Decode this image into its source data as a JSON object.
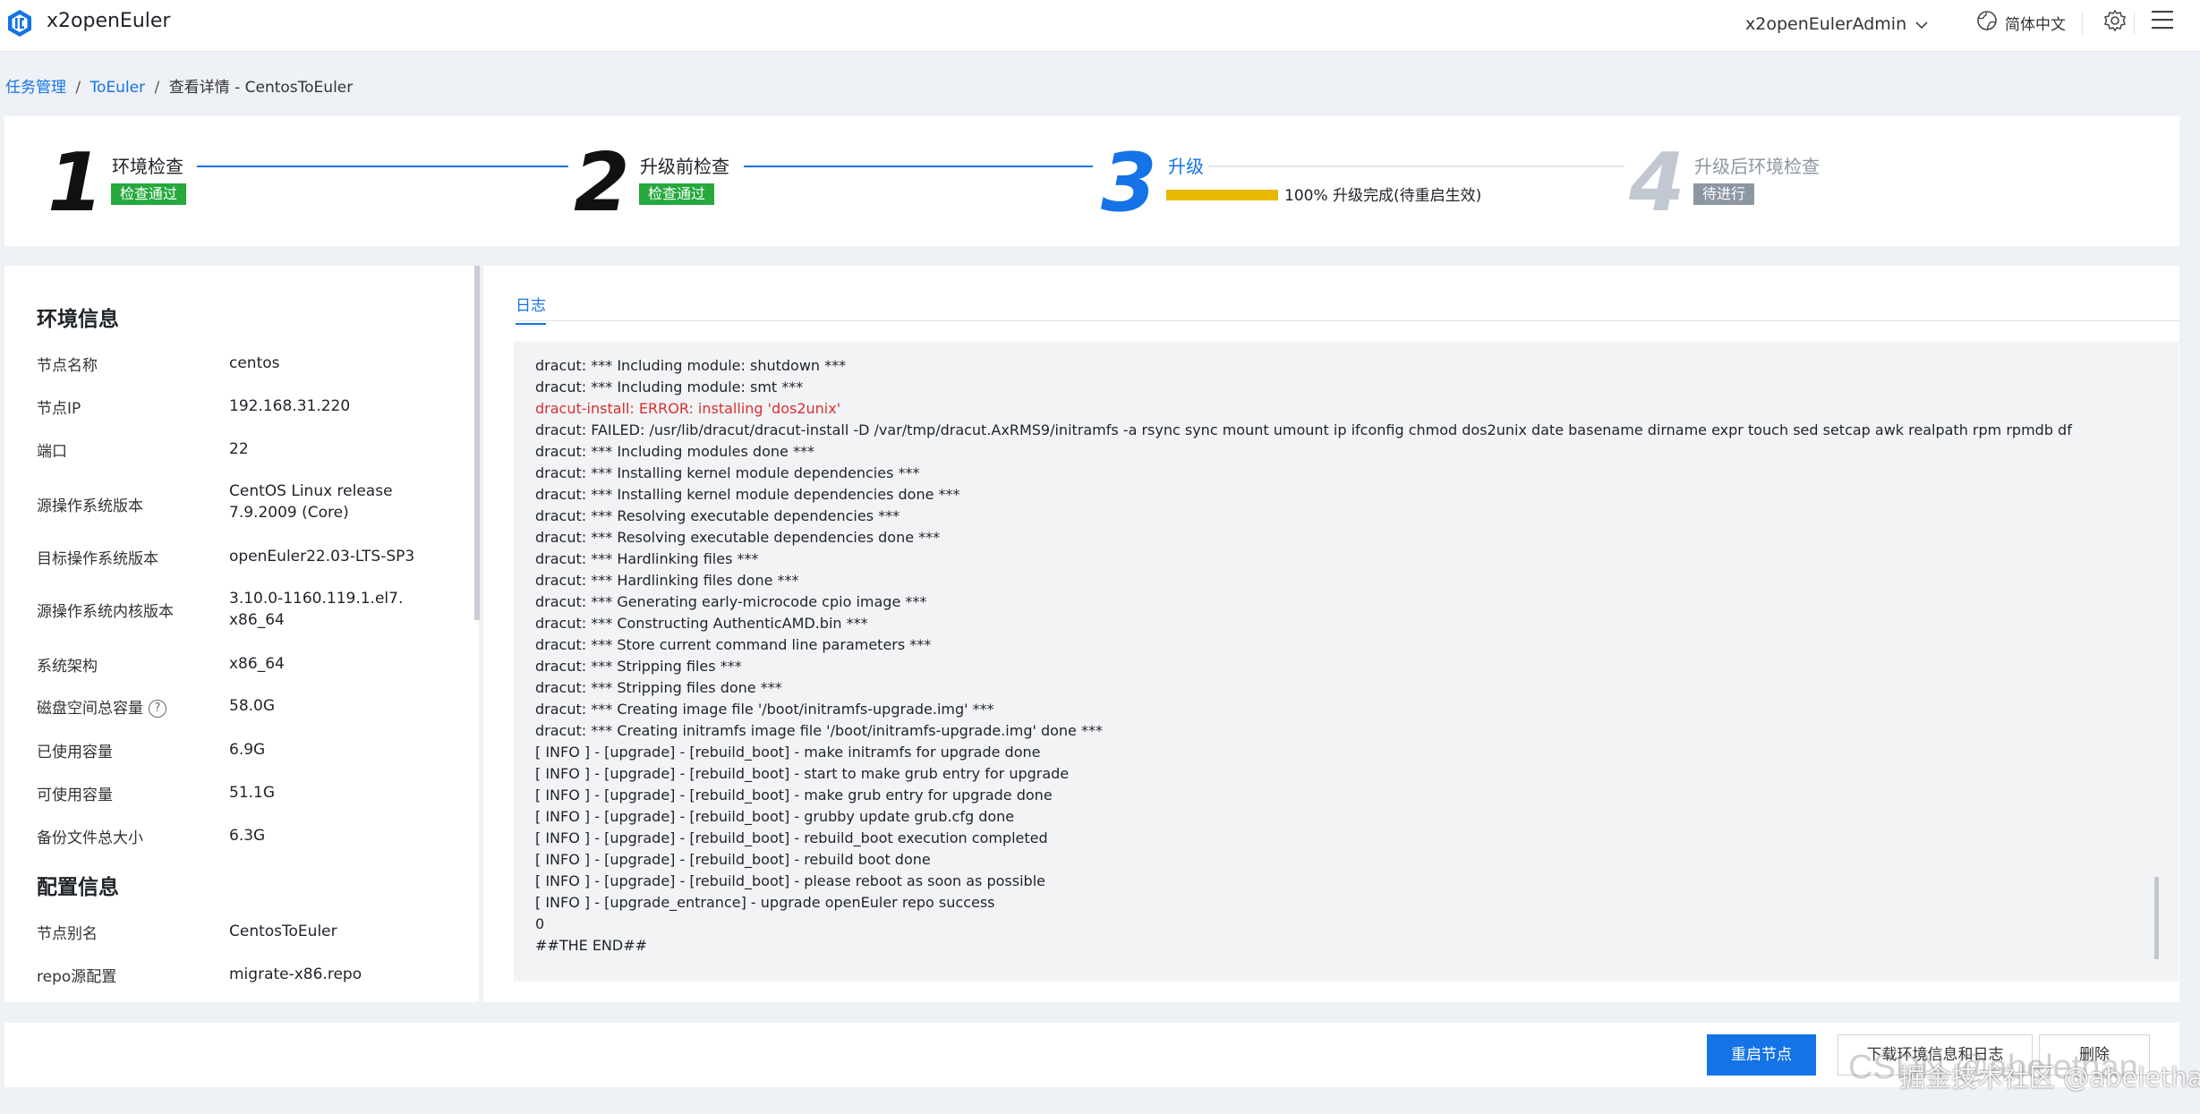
{
  "header": {
    "app_title": "x2openEuler",
    "user_name": "x2openEulerAdmin",
    "language": "简体中文"
  },
  "breadcrumb": {
    "items": [
      "任务管理",
      "ToEuler",
      "查看详情 - CentosToEuler"
    ]
  },
  "steps": [
    {
      "number": "1",
      "title": "环境检查",
      "badge": "检查通过",
      "state": "done"
    },
    {
      "number": "2",
      "title": "升级前检查",
      "badge": "检查通过",
      "state": "done"
    },
    {
      "number": "3",
      "title": "升级",
      "progress_percent": 100,
      "progress_text": "100% 升级完成(待重启生效)",
      "state": "active"
    },
    {
      "number": "4",
      "title": "升级后环境检查",
      "badge": "待进行",
      "state": "pending"
    }
  ],
  "env_info": {
    "title": "环境信息",
    "rows": [
      {
        "label": "节点名称",
        "value": "centos"
      },
      {
        "label": "节点IP",
        "value": "192.168.31.220"
      },
      {
        "label": "端口",
        "value": "22"
      },
      {
        "label": "源操作系统版本",
        "value": "CentOS Linux release 7.9.2009 (Core)"
      },
      {
        "label": "目标操作系统版本",
        "value": "openEuler22.03-LTS-SP3"
      },
      {
        "label": "源操作系统内核版本",
        "value": "3.10.0-1160.119.1.el7.x86_64"
      },
      {
        "label": "系统架构",
        "value": "x86_64"
      },
      {
        "label": "磁盘空间总容量",
        "value": "58.0G"
      },
      {
        "label": "已使用容量",
        "value": "6.9G"
      },
      {
        "label": "可使用容量",
        "value": "51.1G"
      },
      {
        "label": "备份文件总大小",
        "value": "6.3G"
      }
    ]
  },
  "config_info": {
    "title": "配置信息",
    "rows": [
      {
        "label": "节点别名",
        "value": "CentosToEuler"
      },
      {
        "label": "repo源配置",
        "value": "migrate-x86.repo"
      }
    ]
  },
  "log": {
    "tab_label": "日志",
    "lines": [
      {
        "text": "dracut: *** Including module: shutdown ***",
        "error": false
      },
      {
        "text": "dracut: *** Including module: smt ***",
        "error": false
      },
      {
        "text": "dracut-install: ERROR: installing 'dos2unix'",
        "error": true
      },
      {
        "text": "dracut: FAILED: /usr/lib/dracut/dracut-install -D /var/tmp/dracut.AxRMS9/initramfs -a rsync sync mount umount ip ifconfig chmod dos2unix date basename dirname expr touch sed setcap awk realpath rpm rpmdb df",
        "error": false
      },
      {
        "text": "dracut: *** Including modules done ***",
        "error": false
      },
      {
        "text": "dracut: *** Installing kernel module dependencies ***",
        "error": false
      },
      {
        "text": "dracut: *** Installing kernel module dependencies done ***",
        "error": false
      },
      {
        "text": "dracut: *** Resolving executable dependencies ***",
        "error": false
      },
      {
        "text": "dracut: *** Resolving executable dependencies done ***",
        "error": false
      },
      {
        "text": "dracut: *** Hardlinking files ***",
        "error": false
      },
      {
        "text": "dracut: *** Hardlinking files done ***",
        "error": false
      },
      {
        "text": "dracut: *** Generating early-microcode cpio image ***",
        "error": false
      },
      {
        "text": "dracut: *** Constructing AuthenticAMD.bin ***",
        "error": false
      },
      {
        "text": "dracut: *** Store current command line parameters ***",
        "error": false
      },
      {
        "text": "dracut: *** Stripping files ***",
        "error": false
      },
      {
        "text": "dracut: *** Stripping files done ***",
        "error": false
      },
      {
        "text": "dracut: *** Creating image file '/boot/initramfs-upgrade.img' ***",
        "error": false
      },
      {
        "text": "dracut: *** Creating initramfs image file '/boot/initramfs-upgrade.img' done ***",
        "error": false
      },
      {
        "text": "[ INFO ] - [upgrade] - [rebuild_boot] - make initramfs for upgrade done",
        "error": false
      },
      {
        "text": "[ INFO ] - [upgrade] - [rebuild_boot] - start to make grub entry for upgrade",
        "error": false
      },
      {
        "text": "[ INFO ] - [upgrade] - [rebuild_boot] - make grub entry for upgrade done",
        "error": false
      },
      {
        "text": "[ INFO ] - [upgrade] - [rebuild_boot] - grubby update grub.cfg done",
        "error": false
      },
      {
        "text": "[ INFO ] - [upgrade] - [rebuild_boot] - rebuild_boot execution completed",
        "error": false
      },
      {
        "text": "[ INFO ] - [upgrade] - [rebuild_boot] - rebuild boot done",
        "error": false
      },
      {
        "text": "[ INFO ] - [upgrade] - [rebuild_boot] - please reboot as soon as possible",
        "error": false
      },
      {
        "text": "[ INFO ] - [upgrade_entrance] - upgrade openEuler repo success",
        "error": false
      },
      {
        "text": "0",
        "error": false
      },
      {
        "text": "##THE END##",
        "error": false
      }
    ]
  },
  "actions": {
    "reboot_label": "重启节点",
    "download_label": "下载环境信息和日志",
    "delete_label": "删除"
  },
  "watermark": {
    "text": "CSDN @abelethan",
    "text_cn": "掘金技术社区 @abelethan"
  },
  "colors": {
    "primary": "#1473e6",
    "success": "#25a83c",
    "pending": "#8d96a3",
    "progress": "#e6b800",
    "error": "#d93030"
  }
}
